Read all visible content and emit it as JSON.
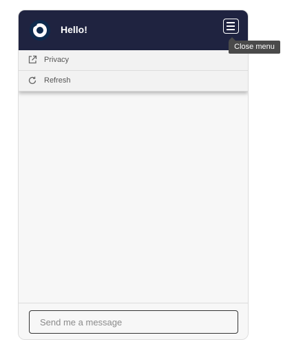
{
  "header": {
    "title": "Hello!",
    "logo_icon": "chat-logo-icon",
    "menu_icon": "hamburger-menu-icon",
    "background": "#1f2340"
  },
  "menu": {
    "items": [
      {
        "label": "Privacy",
        "icon": "external-link-icon"
      },
      {
        "label": "Refresh",
        "icon": "refresh-icon"
      }
    ]
  },
  "tooltip": {
    "text": "Close menu"
  },
  "composer": {
    "placeholder": "Send me a message"
  }
}
